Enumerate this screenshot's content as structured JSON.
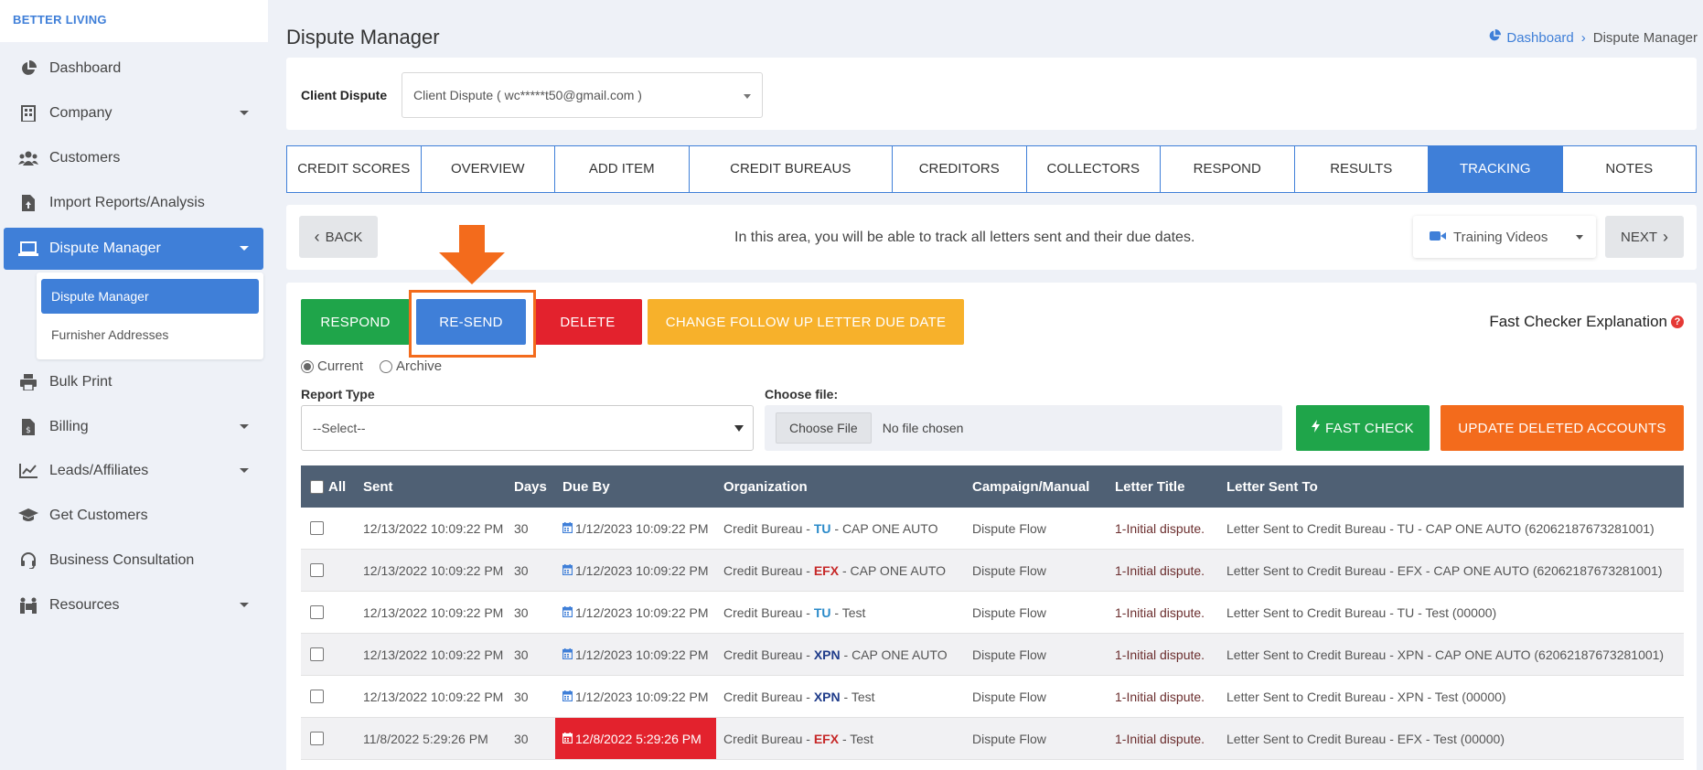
{
  "brand": "BETTER LIVING",
  "sidebar": {
    "items": [
      {
        "label": "Dashboard",
        "icon": "pie-chart-icon"
      },
      {
        "label": "Company",
        "icon": "building-icon"
      },
      {
        "label": "Customers",
        "icon": "users-icon"
      },
      {
        "label": "Import Reports/Analysis",
        "icon": "file-upload-icon"
      },
      {
        "label": "Dispute Manager",
        "icon": "laptop-icon"
      },
      {
        "label": "Bulk Print",
        "icon": "printer-icon"
      },
      {
        "label": "Billing",
        "icon": "invoice-icon"
      },
      {
        "label": "Leads/Affiliates",
        "icon": "line-chart-icon"
      },
      {
        "label": "Get Customers",
        "icon": "graduation-cap-icon"
      },
      {
        "label": "Business Consultation",
        "icon": "headset-icon"
      },
      {
        "label": "Resources",
        "icon": "people-carry-icon"
      }
    ],
    "submenu": [
      "Dispute Manager",
      "Furnisher Addresses"
    ]
  },
  "header": {
    "title": "Dispute Manager",
    "breadcrumb": {
      "home": "Dashboard",
      "current": "Dispute Manager"
    }
  },
  "client": {
    "label": "Client Dispute",
    "value": "Client Dispute ( wc*****t50@gmail.com )"
  },
  "tabs": [
    "CREDIT SCORES",
    "OVERVIEW",
    "ADD ITEM",
    "CREDIT BUREAUS",
    "CREDITORS",
    "COLLECTORS",
    "RESPOND",
    "RESULTS",
    "TRACKING",
    "NOTES"
  ],
  "navbar": {
    "back": "BACK",
    "info": "In this area, you will be able to track all letters sent and their due dates.",
    "training": "Training Videos",
    "next": "NEXT"
  },
  "actions": {
    "respond": "RESPOND",
    "resend": "RE-SEND",
    "delete": "DELETE",
    "change_due": "CHANGE FOLLOW UP LETTER DUE DATE",
    "fast_expl": "Fast Checker Explanation"
  },
  "filters": {
    "current": "Current",
    "archive": "Archive",
    "report_type_label": "Report Type",
    "report_type_value": "--Select--",
    "choose_file_label": "Choose file:",
    "choose_file_btn": "Choose File",
    "no_file": "No file chosen",
    "fast_check": "FAST CHECK",
    "update_deleted": "UPDATE DELETED ACCOUNTS"
  },
  "colors": {
    "primary": "#3f7fd8",
    "green": "#1fa54a",
    "red": "#e3222d",
    "yellow": "#f7b12b",
    "orange": "#f36b1c",
    "table_header": "#4f6074"
  },
  "table": {
    "headers": [
      "All",
      "Sent",
      "Days",
      "Due By",
      "Organization",
      "Campaign/Manual",
      "Letter Title",
      "Letter Sent To"
    ],
    "rows": [
      {
        "sent": "12/13/2022 10:09:22 PM",
        "days": "30",
        "due": "1/12/2023 10:09:22 PM",
        "org_prefix": "Credit Bureau - ",
        "bureau": "TU",
        "bureau_color": "#2a8ac9",
        "org_suffix": " - CAP ONE AUTO",
        "campaign": "Dispute Flow",
        "title": "1-Initial dispute.",
        "sent_to": "Letter Sent to Credit Bureau - TU - CAP ONE AUTO (62062187673281001)"
      },
      {
        "sent": "12/13/2022 10:09:22 PM",
        "days": "30",
        "due": "1/12/2023 10:09:22 PM",
        "org_prefix": "Credit Bureau - ",
        "bureau": "EFX",
        "bureau_color": "#c62828",
        "org_suffix": " - CAP ONE AUTO",
        "campaign": "Dispute Flow",
        "title": "1-Initial dispute.",
        "sent_to": "Letter Sent to Credit Bureau - EFX - CAP ONE AUTO (62062187673281001)"
      },
      {
        "sent": "12/13/2022 10:09:22 PM",
        "days": "30",
        "due": "1/12/2023 10:09:22 PM",
        "org_prefix": "Credit Bureau - ",
        "bureau": "TU",
        "bureau_color": "#2a8ac9",
        "org_suffix": " - Test",
        "campaign": "Dispute Flow",
        "title": "1-Initial dispute.",
        "sent_to": "Letter Sent to Credit Bureau - TU - Test (00000)"
      },
      {
        "sent": "12/13/2022 10:09:22 PM",
        "days": "30",
        "due": "1/12/2023 10:09:22 PM",
        "org_prefix": "Credit Bureau - ",
        "bureau": "XPN",
        "bureau_color": "#1f3c8a",
        "org_suffix": " - CAP ONE AUTO",
        "campaign": "Dispute Flow",
        "title": "1-Initial dispute.",
        "sent_to": "Letter Sent to Credit Bureau - XPN - CAP ONE AUTO (62062187673281001)"
      },
      {
        "sent": "12/13/2022 10:09:22 PM",
        "days": "30",
        "due": "1/12/2023 10:09:22 PM",
        "org_prefix": "Credit Bureau - ",
        "bureau": "XPN",
        "bureau_color": "#1f3c8a",
        "org_suffix": " - Test",
        "campaign": "Dispute Flow",
        "title": "1-Initial dispute.",
        "sent_to": "Letter Sent to Credit Bureau - XPN - Test (00000)"
      },
      {
        "sent": "11/8/2022 5:29:26 PM",
        "days": "30",
        "due": "12/8/2022 5:29:26 PM",
        "overdue": true,
        "org_prefix": "Credit Bureau - ",
        "bureau": "EFX",
        "bureau_color": "#c62828",
        "org_suffix": " - Test",
        "campaign": "Dispute Flow",
        "title": "1-Initial dispute.",
        "sent_to": "Letter Sent to Credit Bureau - EFX - Test (00000)"
      }
    ]
  }
}
